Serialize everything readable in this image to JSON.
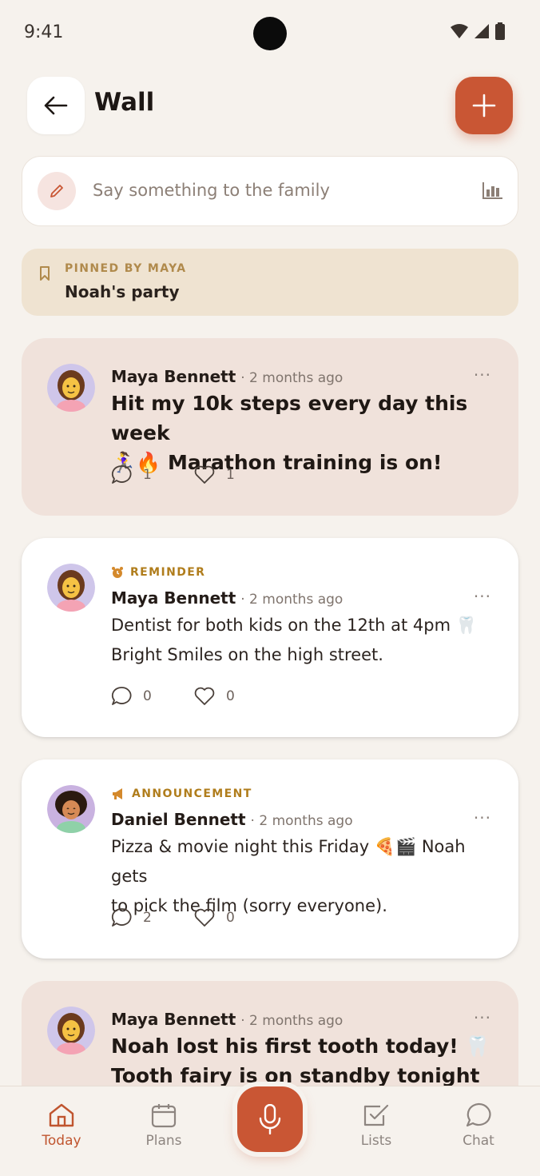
{
  "status": {
    "time": "9:41"
  },
  "header": {
    "title": "Wall"
  },
  "composer": {
    "placeholder": "Say something to the family"
  },
  "pinned": {
    "label": "PINNED BY MAYA",
    "title": "Noah's party"
  },
  "posts": [
    {
      "author": "Maya Bennett",
      "time": "· 2 months ago",
      "kind": "",
      "style": "big",
      "line1": "Hit my 10k steps every day this week",
      "line2": "🏃‍♀️🔥 Marathon training is on!",
      "comments": "1",
      "likes": "1"
    },
    {
      "author": "Maya Bennett",
      "time": "· 2 months ago",
      "kind": "REMINDER",
      "kind_icon": "alarm-clock-icon",
      "line1": "Dentist for both kids on the 12th at 4pm 🦷",
      "line2": "Bright Smiles on the high street.",
      "comments": "0",
      "likes": "0"
    },
    {
      "author": "Daniel Bennett",
      "time": "· 2 months ago",
      "kind": "ANNOUNCEMENT",
      "kind_icon": "megaphone-icon",
      "line1": "Pizza & movie night this Friday 🍕🎬 Noah gets",
      "line2": "to pick the film (sorry everyone).",
      "comments": "2",
      "likes": "0"
    },
    {
      "author": "Maya Bennett",
      "time": "· 2 months ago",
      "kind": "",
      "line1": "Noah lost his first tooth today! 🦷",
      "line2": "Tooth fairy is on standby tonight ✨"
    }
  ],
  "nav": {
    "today": "Today",
    "plans": "Plans",
    "lists": "Lists",
    "chat": "Chat"
  },
  "colors": {
    "accent": "#c95634",
    "bg": "#f6f2ed",
    "tint": "#f0e2db",
    "pinned": "#efe3d1"
  }
}
